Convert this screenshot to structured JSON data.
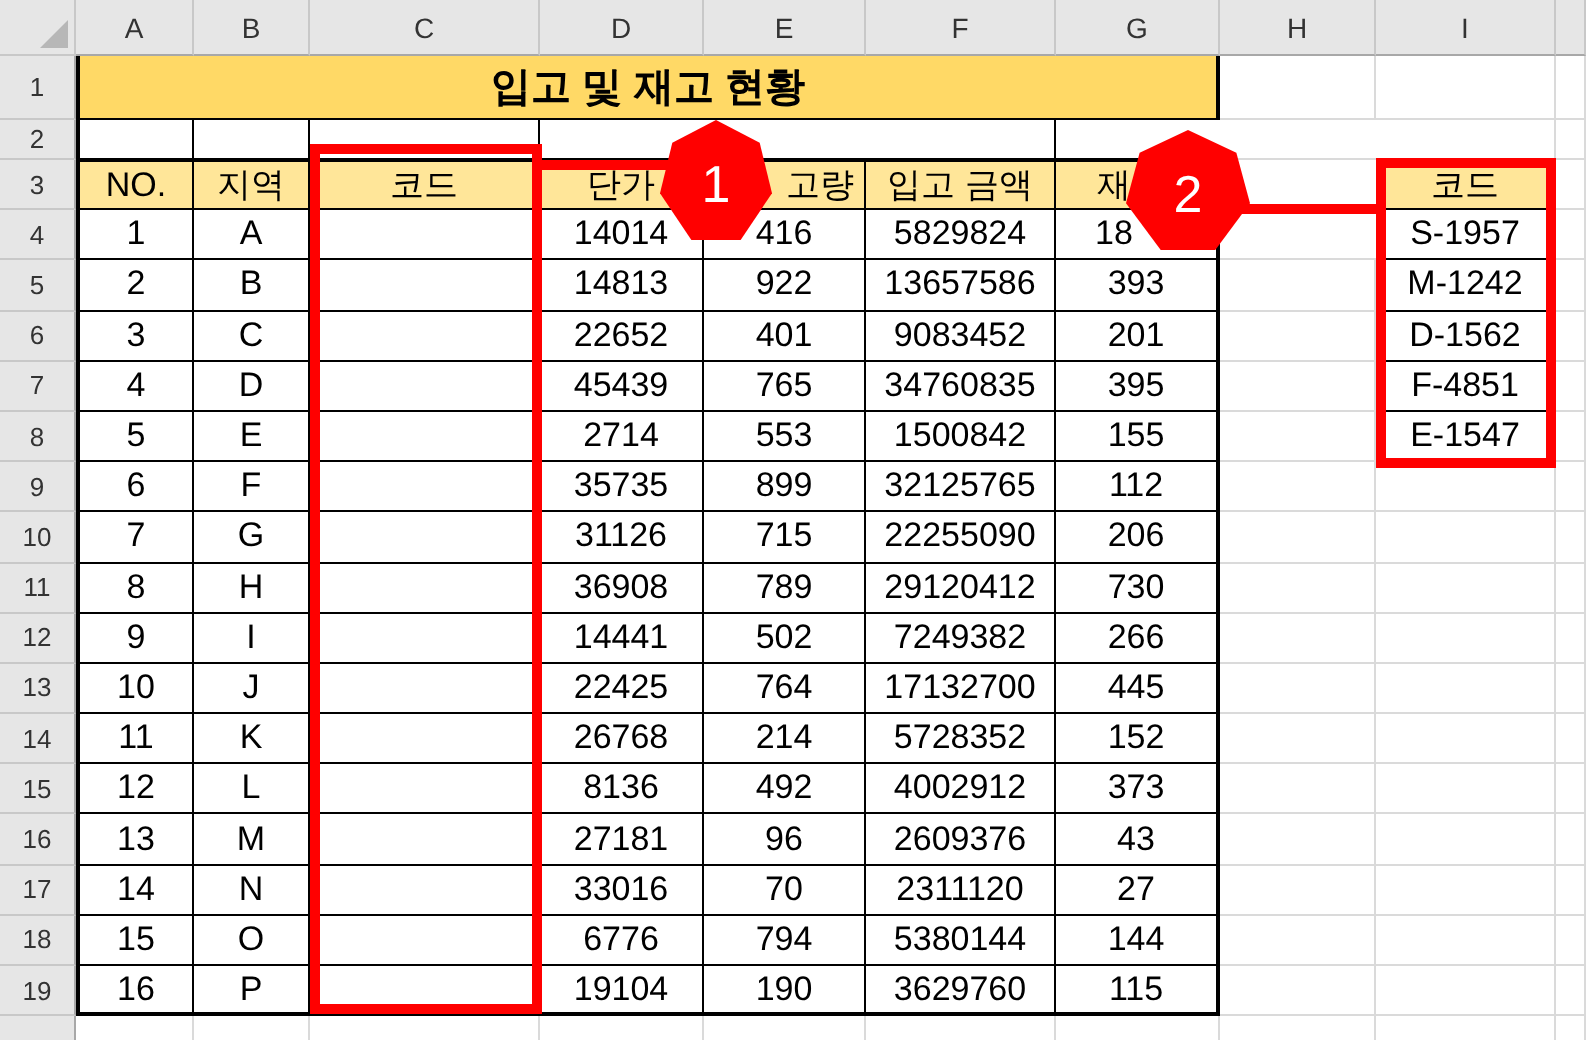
{
  "column_headers": [
    "A",
    "B",
    "C",
    "D",
    "E",
    "F",
    "G",
    "H",
    "I"
  ],
  "row_headers": [
    "1",
    "2",
    "3",
    "4",
    "5",
    "6",
    "7",
    "8",
    "9",
    "10",
    "11",
    "12",
    "13",
    "14",
    "15",
    "16",
    "17",
    "18",
    "19"
  ],
  "title": "입고 및 재고 현황",
  "table": {
    "columns": [
      "NO.",
      "지역",
      "코드",
      "단가",
      "고량",
      "입고 금액",
      "재"
    ],
    "rows": [
      [
        "1",
        "A",
        "",
        "14014",
        "416",
        "5829824",
        "18"
      ],
      [
        "2",
        "B",
        "",
        "14813",
        "922",
        "13657586",
        "393"
      ],
      [
        "3",
        "C",
        "",
        "22652",
        "401",
        "9083452",
        "201"
      ],
      [
        "4",
        "D",
        "",
        "45439",
        "765",
        "34760835",
        "395"
      ],
      [
        "5",
        "E",
        "",
        "2714",
        "553",
        "1500842",
        "155"
      ],
      [
        "6",
        "F",
        "",
        "35735",
        "899",
        "32125765",
        "112"
      ],
      [
        "7",
        "G",
        "",
        "31126",
        "715",
        "22255090",
        "206"
      ],
      [
        "8",
        "H",
        "",
        "36908",
        "789",
        "29120412",
        "730"
      ],
      [
        "9",
        "I",
        "",
        "14441",
        "502",
        "7249382",
        "266"
      ],
      [
        "10",
        "J",
        "",
        "22425",
        "764",
        "17132700",
        "445"
      ],
      [
        "11",
        "K",
        "",
        "26768",
        "214",
        "5728352",
        "152"
      ],
      [
        "12",
        "L",
        "",
        "8136",
        "492",
        "4002912",
        "373"
      ],
      [
        "13",
        "M",
        "",
        "27181",
        "96",
        "2609376",
        "43"
      ],
      [
        "14",
        "N",
        "",
        "33016",
        "70",
        "2311120",
        "27"
      ],
      [
        "15",
        "O",
        "",
        "6776",
        "794",
        "5380144",
        "144"
      ],
      [
        "16",
        "P",
        "",
        "19104",
        "190",
        "3629760",
        "115"
      ]
    ]
  },
  "code_list": {
    "header": "코드",
    "items": [
      "S-1957",
      "M-1242",
      "D-1562",
      "F-4851",
      "E-1547"
    ]
  },
  "callouts": [
    {
      "label": "1"
    },
    {
      "label": "2"
    }
  ]
}
